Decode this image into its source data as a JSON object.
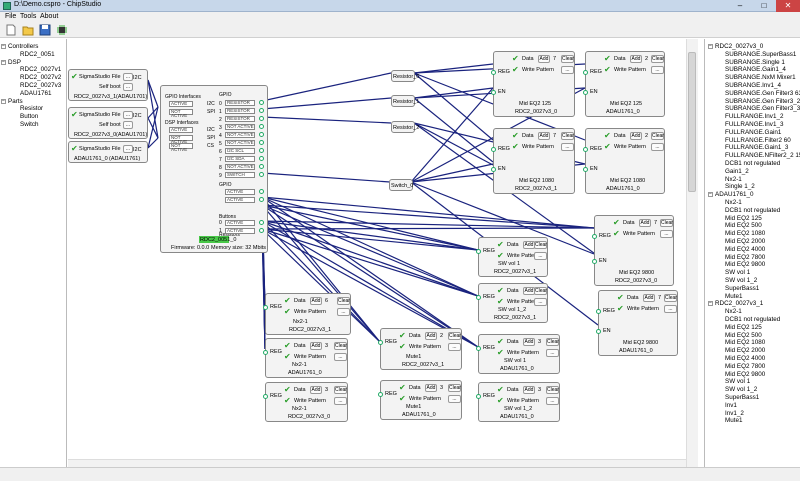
{
  "window": {
    "title": "D:\\Demo.cspro - ChipStudio",
    "minimize": "–",
    "maximize": "□",
    "close": "✕"
  },
  "menu": [
    "File",
    "Tools",
    "About"
  ],
  "toolbar": [
    "new-file-icon",
    "open-folder-icon",
    "save-icon",
    "chip-icon"
  ],
  "left_tree": [
    {
      "label": "Controllers",
      "level": 0,
      "expand": "−"
    },
    {
      "label": "RDC2_0051",
      "level": 1
    },
    {
      "label": "DSP",
      "level": 0,
      "expand": "−"
    },
    {
      "label": "RDC2_0027v1",
      "level": 1
    },
    {
      "label": "RDC2_0027v2",
      "level": 1
    },
    {
      "label": "RDC2_0027v3",
      "level": 1
    },
    {
      "label": "ADAU1761",
      "level": 1
    },
    {
      "label": "Parts",
      "level": 0,
      "expand": "−"
    },
    {
      "label": "Resistor",
      "level": 1
    },
    {
      "label": "Button",
      "level": 1
    },
    {
      "label": "Switch",
      "level": 1
    }
  ],
  "right_tree": [
    {
      "label": "RDC2_0027v3_0",
      "level": 0,
      "expand": "−"
    },
    {
      "label": "SUBRANGE.SuperBass1",
      "level": 1
    },
    {
      "label": "SUBRANGE.Single 1",
      "level": 1
    },
    {
      "label": "SUBRANGE.Gain1_4",
      "level": 1
    },
    {
      "label": "SUBRANGE.NxM Mixer1",
      "level": 1
    },
    {
      "label": "SUBRANGE.Inv1_4",
      "level": 1
    },
    {
      "label": "SUBRANGE.Gen Filter3 63",
      "level": 1
    },
    {
      "label": "SUBRANGE.Gen Filter3_2 60",
      "level": 1
    },
    {
      "label": "SUBRANGE.Gen Filter3_3 20",
      "level": 1
    },
    {
      "label": "FULLRANGE.Inv1_2",
      "level": 1
    },
    {
      "label": "FULLRANGE.Inv1_3",
      "level": 1
    },
    {
      "label": "FULLRANGE.Gain1",
      "level": 1
    },
    {
      "label": "FULLRANGE.Filter2 60",
      "level": 1
    },
    {
      "label": "FULLRANGE.Gain1_3",
      "level": 1
    },
    {
      "label": "FULLRANGE.NFilter2_2 150",
      "level": 1
    },
    {
      "label": "DCB1 not regulated",
      "level": 1
    },
    {
      "label": "Gain1_2",
      "level": 1
    },
    {
      "label": "Nx2-1",
      "level": 1
    },
    {
      "label": "Single 1_2",
      "level": 1
    },
    {
      "label": "ADAU1761_0",
      "level": 0,
      "expand": "−"
    },
    {
      "label": "Nx2-1",
      "level": 1
    },
    {
      "label": "DCB1 not regulated",
      "level": 1
    },
    {
      "label": "Mid EQ2 125",
      "level": 1
    },
    {
      "label": "Mid EQ2 500",
      "level": 1
    },
    {
      "label": "Mid EQ2 1080",
      "level": 1
    },
    {
      "label": "Mid EQ2 2000",
      "level": 1
    },
    {
      "label": "Mid EQ2 4000",
      "level": 1
    },
    {
      "label": "Mid EQ2 7800",
      "level": 1
    },
    {
      "label": "Mid EQ2 9800",
      "level": 1
    },
    {
      "label": "SW vol 1",
      "level": 1
    },
    {
      "label": "SW vol 1_2",
      "level": 1
    },
    {
      "label": "SuperBass1",
      "level": 1
    },
    {
      "label": "Mute1",
      "level": 1
    },
    {
      "label": "RDC2_0027v3_1",
      "level": 0,
      "expand": "−"
    },
    {
      "label": "Nx2-1",
      "level": 1
    },
    {
      "label": "DCB1 not regulated",
      "level": 1
    },
    {
      "label": "Mid EQ2 125",
      "level": 1
    },
    {
      "label": "Mid EQ2 500",
      "level": 1
    },
    {
      "label": "Mid EQ2 1080",
      "level": 1
    },
    {
      "label": "Mid EQ2 2000",
      "level": 1
    },
    {
      "label": "Mid EQ2 4000",
      "level": 1
    },
    {
      "label": "Mid EQ2 7800",
      "level": 1
    },
    {
      "label": "Mid EQ2 9800",
      "level": 1
    },
    {
      "label": "SW vol 1",
      "level": 1
    },
    {
      "label": "SW vol 1_2",
      "level": 1
    },
    {
      "label": "SuperBass1",
      "level": 1
    },
    {
      "label": "Inv1",
      "level": 1
    },
    {
      "label": "Inv1_2",
      "level": 1
    },
    {
      "label": "Mute1",
      "level": 1
    }
  ],
  "dsp_blocks": [
    {
      "file": "SigmaStudio File",
      "bus": "I2C",
      "selfboot": "Self boot",
      "name": "RDC2_0027v3_1",
      "chip": "(ADAU1701)"
    },
    {
      "file": "SigmaStudio File",
      "bus": "I2C",
      "selfboot": "Self boot",
      "name": "RDC2_0027v3_0",
      "chip": "(ADAU1701)"
    },
    {
      "file": "SigmaStudio File",
      "bus": "I2C",
      "name": "ADAU1761_0",
      "chip": "(ADAU1761)"
    }
  ],
  "controller": {
    "gpio_title": "GPIO Interfaces",
    "dsp_title": "DSP Interfaces",
    "gpio_rows": [
      {
        "v": "ACTIVE",
        "n": "I2C"
      },
      {
        "v": "NOT ACTIVE",
        "n": "SPI"
      }
    ],
    "dsp_rows": [
      {
        "v": "ACTIVE",
        "n": "I2C"
      },
      {
        "v": "NOT ACTIVE",
        "n": "SPI"
      },
      {
        "v": "NOT ACTIVE",
        "n": "CS"
      }
    ],
    "gpio_labels": [
      "GPIO",
      "0",
      "1",
      "2",
      "3",
      "4",
      "5",
      "6",
      "7",
      "8",
      "9"
    ],
    "pin_values": [
      "RESISTOR",
      "RESISTOR",
      "RESISTOR",
      "NOT ACTIVE",
      "NOT ACTIVE",
      "NOT ACTIVE",
      "I2C SCL",
      "I2C SDA",
      "NOT ACTIVE",
      "SWITCH"
    ],
    "resistors_title": "Resistors",
    "resistor_rows": [
      "ACTIVE",
      "ACTIVE"
    ],
    "buttons_title": "Buttons",
    "button_rows": [
      "ACTIVE",
      "ACTIVE"
    ],
    "name": "RDC2_0051_0",
    "firmware": "Firmware: 0.0.0",
    "memory": "Memory size: 32 Mbits"
  },
  "parts": [
    {
      "name": "Resistor_0"
    },
    {
      "name": "Resistor_1"
    },
    {
      "name": "Resistor_2"
    },
    {
      "name": "Switch_0"
    }
  ],
  "param_blocks": [
    {
      "reg": "REG",
      "en": "EN",
      "data": "Data",
      "add": "Add",
      "count": "7",
      "clear": "Clear",
      "write": "Write Pattern",
      "dots": "...",
      "title": "Mid EQ2 125",
      "chip": "RDC2_0027v3_0"
    },
    {
      "reg": "REG",
      "en": "EN",
      "data": "Data",
      "add": "Add",
      "count": "2",
      "clear": "Clear",
      "write": "Write Pattern",
      "dots": "...",
      "title": "Mid EQ2 125",
      "chip": "ADAU1761_0"
    },
    {
      "reg": "REG",
      "en": "EN",
      "data": "Data",
      "add": "Add",
      "count": "7",
      "clear": "Clear",
      "write": "Write Pattern",
      "dots": "...",
      "title": "Mid EQ2 1080",
      "chip": "RDC2_0027v3_1"
    },
    {
      "reg": "REG",
      "en": "EN",
      "data": "Data",
      "add": "Add",
      "count": "2",
      "clear": "Clear",
      "write": "Write Pattern",
      "dots": "...",
      "title": "Mid EQ2 1080",
      "chip": "ADAU1761_0"
    },
    {
      "reg": "REG",
      "en": "EN",
      "data": "Data",
      "add": "Add",
      "count": "7",
      "clear": "Clear",
      "write": "Write Pattern",
      "dots": "...",
      "title": "Mid EQ2 9800",
      "chip": "RDC2_0027v3_0"
    },
    {
      "reg": "REG",
      "en": "EN",
      "data": "Data",
      "add": "Add",
      "count": "7",
      "clear": "Clear",
      "write": "Write Pattern",
      "dots": "...",
      "title": "Mid EQ2 9800",
      "chip": "ADAU1761_0"
    },
    {
      "reg": "REG",
      "data": "Data",
      "add": "Add",
      "count": "3",
      "clear": "Clear",
      "write": "Write Pattern",
      "dots": "...",
      "title": "SW vol 1",
      "chip": "RDC2_0027v3_1"
    },
    {
      "reg": "REG",
      "data": "Data",
      "add": "Add",
      "count": "3",
      "clear": "Clear",
      "write": "Write Pattern",
      "dots": "...",
      "title": "SW vol 1_2",
      "chip": "RDC2_0027v3_1"
    },
    {
      "reg": "REG",
      "data": "Data",
      "add": "Add",
      "count": "6",
      "clear": "Clear",
      "write": "Write Pattern",
      "dots": "...",
      "title": "Nx2-1",
      "chip": "RDC2_0027v3_1"
    },
    {
      "reg": "REG",
      "data": "Data",
      "add": "Add",
      "count": "3",
      "clear": "Clear",
      "write": "Write Pattern",
      "dots": "...",
      "title": "Nx2-1",
      "chip": "ADAU1761_0"
    },
    {
      "reg": "REG",
      "data": "Data",
      "add": "Add",
      "count": "3",
      "clear": "Clear",
      "write": "Write Pattern",
      "dots": "...",
      "title": "Nx2-1",
      "chip": "RDC2_0027v3_0"
    },
    {
      "reg": "REG",
      "data": "Data",
      "add": "Add",
      "count": "2",
      "clear": "Clear",
      "write": "Write Pattern",
      "dots": "...",
      "title": "Mute1",
      "chip": "RDC2_0027v3_1"
    },
    {
      "reg": "REG",
      "data": "Data",
      "add": "Add",
      "count": "3",
      "clear": "Clear",
      "write": "Write Pattern",
      "dots": "...",
      "title": "Mute1",
      "chip": "ADAU1761_0"
    },
    {
      "reg": "REG",
      "data": "Data",
      "add": "Add",
      "count": "3",
      "clear": "Clear",
      "write": "Write Pattern",
      "dots": "...",
      "title": "SW vol 1",
      "chip": "ADAU1761_0"
    },
    {
      "reg": "REG",
      "data": "Data",
      "add": "Add",
      "count": "3",
      "clear": "Clear",
      "write": "Write Pattern",
      "dots": "...",
      "title": "SW vol 1_2",
      "chip": "ADAU1761_0"
    }
  ],
  "colors": {
    "wire": "#1a237e",
    "accent": "#48c848",
    "check": "#2a9d2a"
  }
}
